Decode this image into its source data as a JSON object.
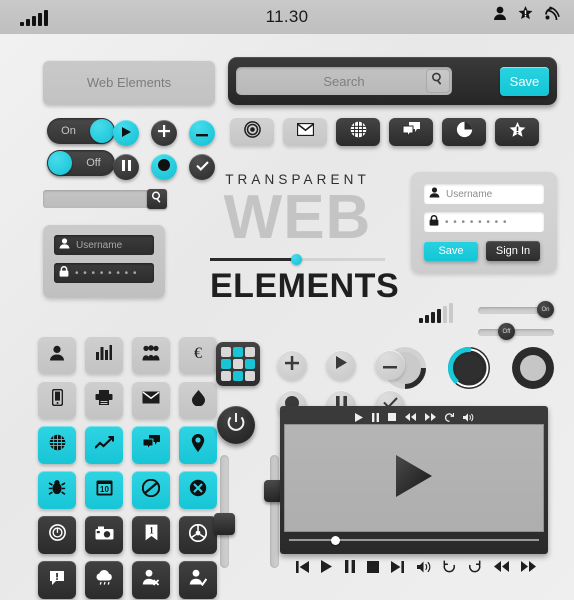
{
  "statusbar": {
    "time": "11.30",
    "signal_bars": [
      4,
      7,
      10,
      13,
      16
    ],
    "icons": [
      "person-icon",
      "star-alert-icon",
      "wifi-icon"
    ]
  },
  "title_bar": {
    "label": "Web Elements"
  },
  "toggles": [
    {
      "name": "toggle-on",
      "label": "On",
      "state": "on"
    },
    {
      "name": "toggle-off",
      "label": "Off",
      "state": "off"
    }
  ],
  "circle_buttons": [
    {
      "icon": "play-icon",
      "color": "cyan"
    },
    {
      "icon": "plus-icon",
      "color": "dark"
    },
    {
      "icon": "minus-icon",
      "color": "cyan"
    },
    {
      "icon": "pause-icon",
      "color": "dark"
    },
    {
      "icon": "record-icon",
      "color": "cyan"
    },
    {
      "icon": "check-icon",
      "color": "dark"
    }
  ],
  "search_left": {
    "value": "",
    "icon": "search-icon"
  },
  "search_panel": {
    "placeholder": "Search",
    "value": "",
    "magnifier_icon": "search-icon",
    "save_label": "Save"
  },
  "pill_row": [
    {
      "icon": "target-icon",
      "style": "light"
    },
    {
      "icon": "mail-icon",
      "style": "light"
    },
    {
      "icon": "globe-icon",
      "style": "dark"
    },
    {
      "icon": "chat-icon",
      "style": "dark"
    },
    {
      "icon": "pie-chart-icon",
      "style": "dark"
    },
    {
      "icon": "star-badge-icon",
      "style": "dark"
    }
  ],
  "hero": {
    "line1": "TRANSPARENT",
    "line2": "WEB",
    "line3": "ELEMENTS",
    "slider_value": 46
  },
  "login_dark": {
    "username_placeholder": "Username",
    "password_value": "• • • • • • • •",
    "user_icon": "person-icon",
    "lock_icon": "lock-icon"
  },
  "login_light": {
    "username_placeholder": "Username",
    "password_value": "• • • • • • • •",
    "user_icon": "person-icon",
    "lock_icon": "lock-icon",
    "save_label": "Save",
    "signin_label": "Sign In"
  },
  "mini_signal": {
    "bars": [
      4,
      7,
      10,
      13,
      16
    ],
    "active": 3
  },
  "h_sliders": [
    {
      "name": "slider-on",
      "label": "On",
      "position": 76
    },
    {
      "name": "slider-off",
      "label": "Off",
      "position": 30
    }
  ],
  "progress_rings": [
    {
      "name": "ring-light",
      "percent": 25,
      "style": "light"
    },
    {
      "name": "ring-cyan",
      "percent": 40,
      "style": "cyan"
    },
    {
      "name": "ring-dark",
      "percent": 100,
      "style": "dark"
    }
  ],
  "icon_grid": [
    {
      "icon": "person-icon",
      "style": "gray"
    },
    {
      "icon": "bar-chart-icon",
      "style": "gray"
    },
    {
      "icon": "group-icon",
      "style": "gray"
    },
    {
      "icon": "euro-icon",
      "style": "gray"
    },
    {
      "icon": "phone-icon",
      "style": "gray"
    },
    {
      "icon": "printer-icon",
      "style": "gray"
    },
    {
      "icon": "envelope-icon",
      "style": "gray"
    },
    {
      "icon": "droplet-icon",
      "style": "gray"
    },
    {
      "icon": "globe-icon",
      "style": "cyan"
    },
    {
      "icon": "line-chart-icon",
      "style": "cyan"
    },
    {
      "icon": "chat-icon",
      "style": "cyan"
    },
    {
      "icon": "location-pin-icon",
      "style": "cyan"
    },
    {
      "icon": "bug-icon",
      "style": "cyan"
    },
    {
      "icon": "calendar-icon",
      "style": "cyan",
      "badge": "10"
    },
    {
      "icon": "block-icon",
      "style": "cyan"
    },
    {
      "icon": "block-x-icon",
      "style": "cyan"
    },
    {
      "icon": "watch-icon",
      "style": "dark"
    },
    {
      "icon": "camera-icon",
      "style": "dark"
    },
    {
      "icon": "bookmark-icon",
      "style": "dark"
    },
    {
      "icon": "steering-wheel-icon",
      "style": "dark"
    },
    {
      "icon": "speech-alert-icon",
      "style": "dark"
    },
    {
      "icon": "cloud-rain-icon",
      "style": "dark"
    },
    {
      "icon": "user-remove-icon",
      "style": "dark"
    },
    {
      "icon": "user-check-icon",
      "style": "dark"
    }
  ],
  "mini_panel": {
    "cells": [
      {
        "icon": "apps-icon",
        "color": "#d8d8d8"
      },
      {
        "icon": "brush-icon",
        "color": "#18c4d6"
      },
      {
        "icon": "moon-icon",
        "color": "#d8d8d8"
      },
      {
        "icon": "photo-icon",
        "color": "#18c4d6"
      },
      {
        "icon": "mountain-icon",
        "color": "#d8d8d8"
      },
      {
        "icon": "flag-icon",
        "color": "#18c4d6"
      },
      {
        "icon": "gift-icon",
        "color": "#d8d8d8"
      },
      {
        "icon": "circle-icon",
        "color": "#18c4d6"
      },
      {
        "icon": "moon2-icon",
        "color": "#d8d8d8"
      }
    ]
  },
  "power_button": {
    "icon": "power-icon"
  },
  "gray_circles": [
    {
      "icon": "plus-icon"
    },
    {
      "icon": "play-icon"
    },
    {
      "icon": "minus-icon"
    },
    {
      "icon": "record-icon"
    },
    {
      "icon": "pause-icon"
    },
    {
      "icon": "check-icon"
    }
  ],
  "v_sliders": [
    {
      "name": "vslider-left",
      "value": 38
    },
    {
      "name": "vslider-right",
      "value": 72
    }
  ],
  "player": {
    "top_controls": [
      "play-icon",
      "pause-icon",
      "stop-icon",
      "rewind-icon",
      "fast-forward-icon",
      "refresh-icon",
      "volume-icon"
    ],
    "screen_icon": "play-icon",
    "progress_percent": 18,
    "bottom_controls": [
      "prev-track-icon",
      "play-icon",
      "pause-icon",
      "stop-icon",
      "next-track-icon",
      "volume-icon",
      "refresh-ccw-icon",
      "refresh-cw-icon",
      "rewind-icon",
      "fast-forward-icon"
    ]
  },
  "colors": {
    "accent": "#18c7d8",
    "dark": "#2b2b2b",
    "gray": "#c6c6c6",
    "background": "#eeeeee"
  }
}
